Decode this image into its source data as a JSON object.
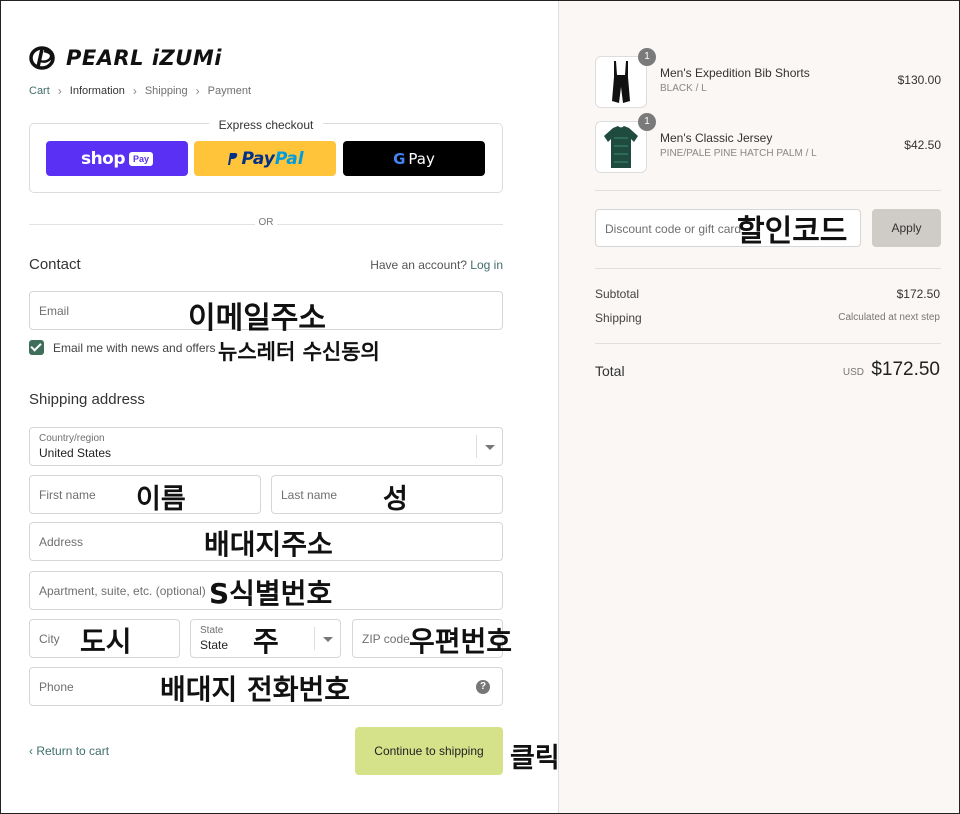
{
  "brand": {
    "name": "PEARL iZUMi"
  },
  "breadcrumb": [
    "Cart",
    "Information",
    "Shipping",
    "Payment"
  ],
  "express": {
    "title": "Express checkout",
    "shop_pay": {
      "word": "shop",
      "badge": "Pay"
    },
    "paypal": {
      "word1": "Pay",
      "word2": "Pal"
    },
    "gpay": {
      "g": "G",
      "word": "Pay"
    }
  },
  "or_label": "OR",
  "contact": {
    "title": "Contact",
    "account_prompt": "Have an account?",
    "login_label": "Log in",
    "email_placeholder": "Email",
    "newsletter_label": "Email me with news and offers",
    "newsletter_checked": true
  },
  "shipping": {
    "title": "Shipping address",
    "country_label": "Country/region",
    "country_value": "United States",
    "first_name_placeholder": "First name",
    "last_name_placeholder": "Last name",
    "address_placeholder": "Address",
    "apartment_placeholder": "Apartment, suite, etc. (optional)",
    "city_placeholder": "City",
    "state_label": "State",
    "state_value": "State",
    "zip_placeholder": "ZIP code",
    "phone_placeholder": "Phone"
  },
  "annotations": {
    "email": "이메일주소",
    "newsletter": "뉴스레터 수신동의",
    "first_name": "이름",
    "last_name": "성",
    "address": "배대지주소",
    "apartment": "S식별번호",
    "city": "도시",
    "state": "주",
    "zip": "우편번호",
    "phone": "배대지 전화번호",
    "continue": "클릭",
    "discount": "할인코드"
  },
  "footer": {
    "return_label": "Return to cart",
    "continue_label": "Continue to shipping"
  },
  "order": {
    "items": [
      {
        "name": "Men's Expedition Bib Shorts",
        "variant": "BLACK / L",
        "price": "$130.00",
        "qty": "1"
      },
      {
        "name": "Men's Classic Jersey",
        "variant": "PINE/PALE PINE HATCH PALM / L",
        "price": "$42.50",
        "qty": "1"
      }
    ],
    "discount_placeholder": "Discount code or gift card",
    "apply_label": "Apply",
    "subtotal_label": "Subtotal",
    "subtotal_value": "$172.50",
    "shipping_label": "Shipping",
    "shipping_value": "Calculated at next step",
    "total_label": "Total",
    "currency": "USD",
    "total_value": "$172.50"
  },
  "colors": {
    "accent": "#3f6f6a",
    "shop_pay": "#5a31f4",
    "paypal": "#ffc439",
    "gpay": "#000000",
    "continue_button": "#d6e28a",
    "sidebar_bg": "#faf7f4"
  }
}
